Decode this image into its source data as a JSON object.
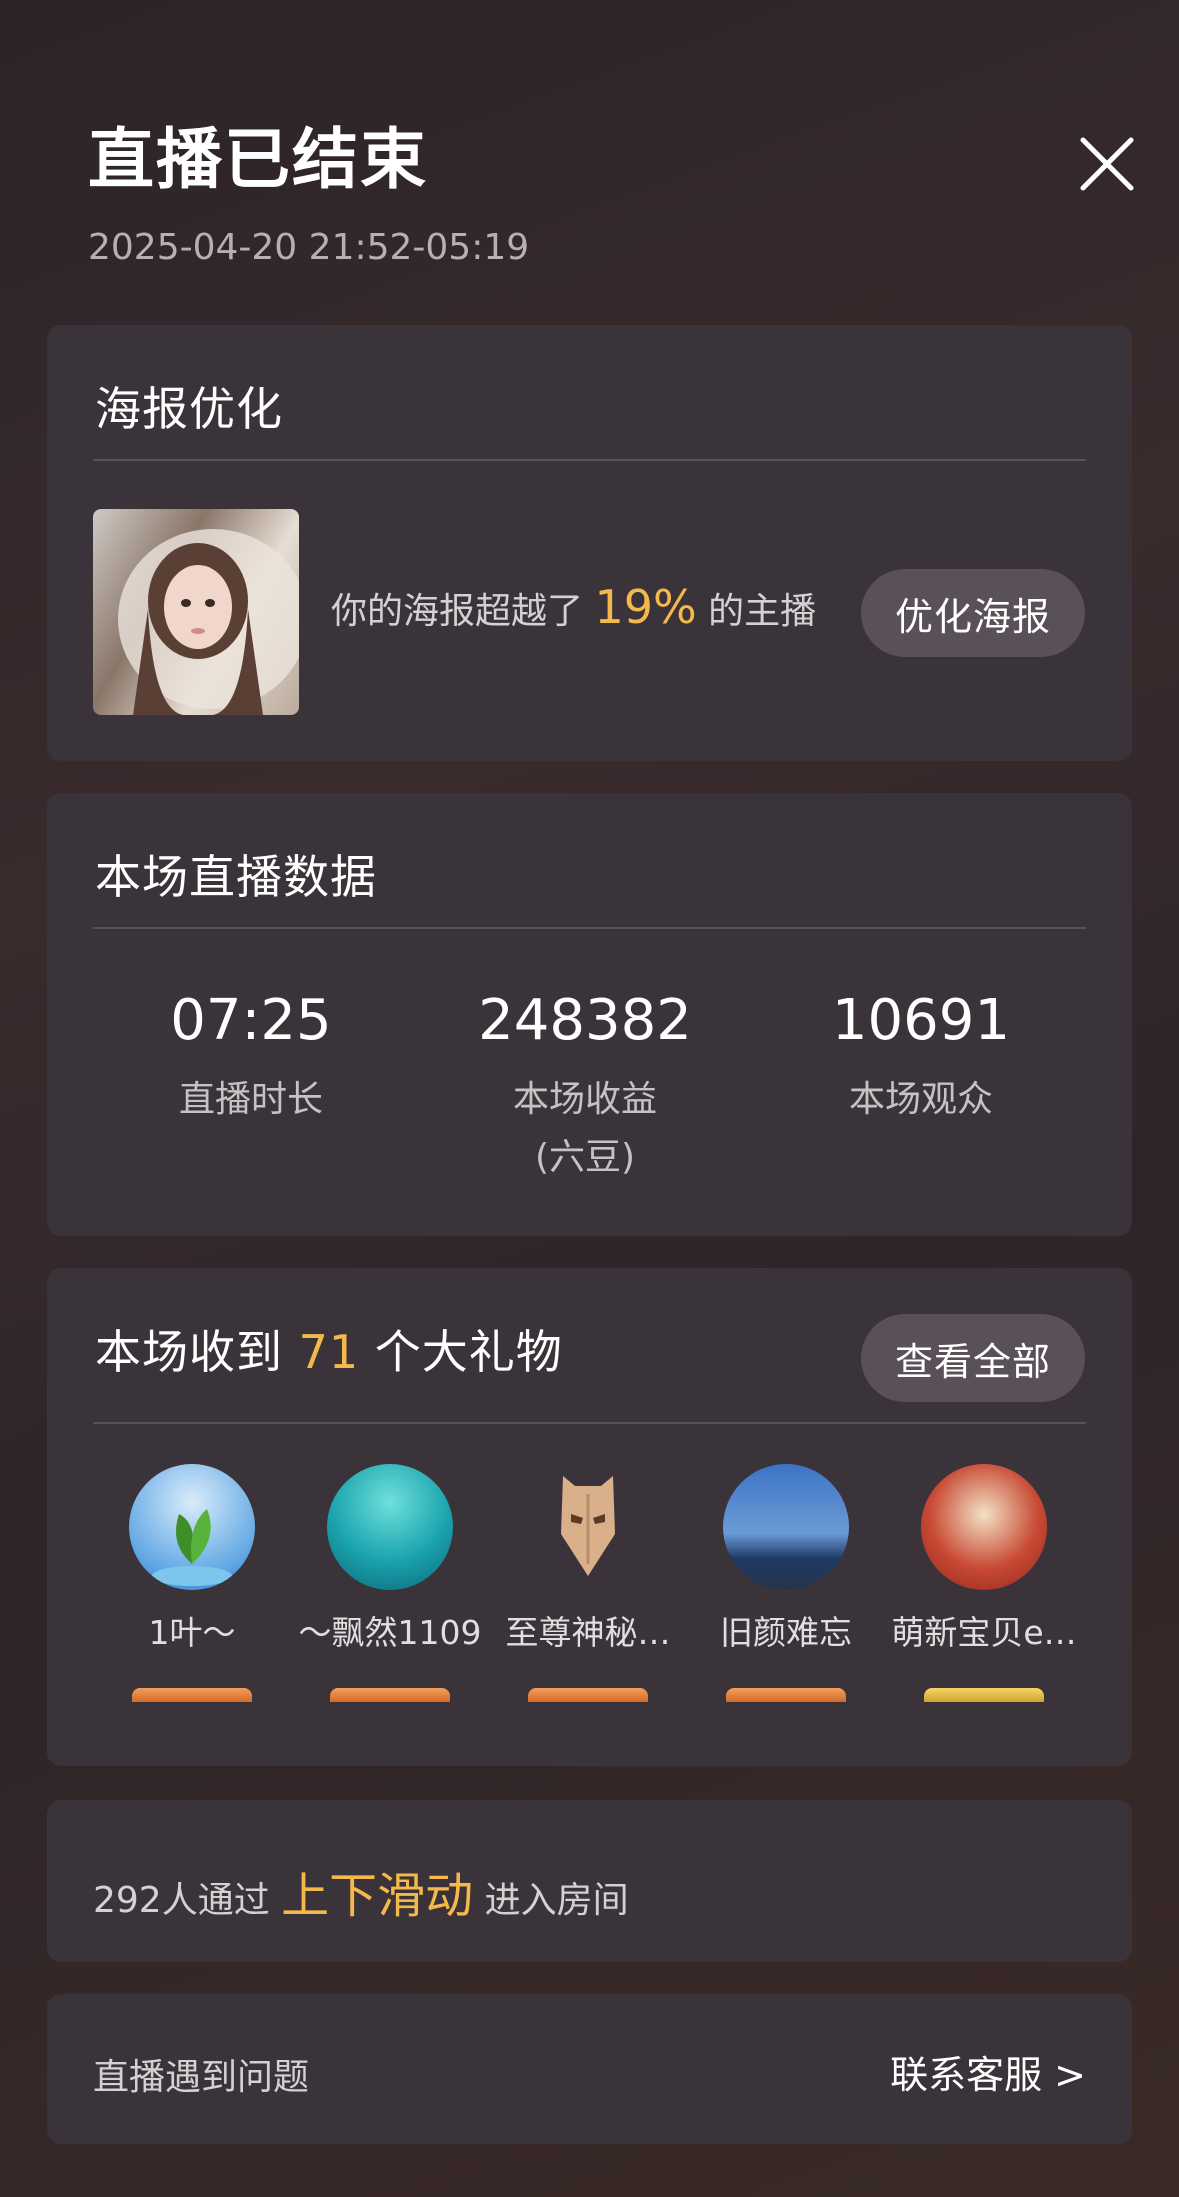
{
  "header": {
    "title": "直播已结束",
    "time_range": "2025-04-20 21:52-05:19"
  },
  "poster": {
    "title": "海报优化",
    "text_prefix": "你的海报超越了",
    "percent": "19%",
    "text_suffix": "的主播",
    "button": "优化海报"
  },
  "stats": {
    "title": "本场直播数据",
    "items": [
      {
        "value": "07:25",
        "label": "直播时长"
      },
      {
        "value": "248382",
        "label": "本场收益\n(六豆)"
      },
      {
        "value": "10691",
        "label": "本场观众"
      }
    ]
  },
  "gifts": {
    "title_prefix": "本场收到",
    "count": "71",
    "title_suffix": "个大礼物",
    "button": "查看全部",
    "gifters": [
      {
        "name": "1叶～"
      },
      {
        "name": "～飘然1109"
      },
      {
        "name": "至尊神秘…"
      },
      {
        "name": "旧颜难忘"
      },
      {
        "name": "萌新宝贝e…"
      }
    ]
  },
  "slide": {
    "prefix": "292人通过",
    "highlight": "上下滑动",
    "suffix": "进入房间"
  },
  "help": {
    "label": "直播遇到问题",
    "link": "联系客服 >"
  },
  "colors": {
    "accent": "#f4b94a",
    "card": "#3a3339",
    "pill": "#5a5058"
  }
}
